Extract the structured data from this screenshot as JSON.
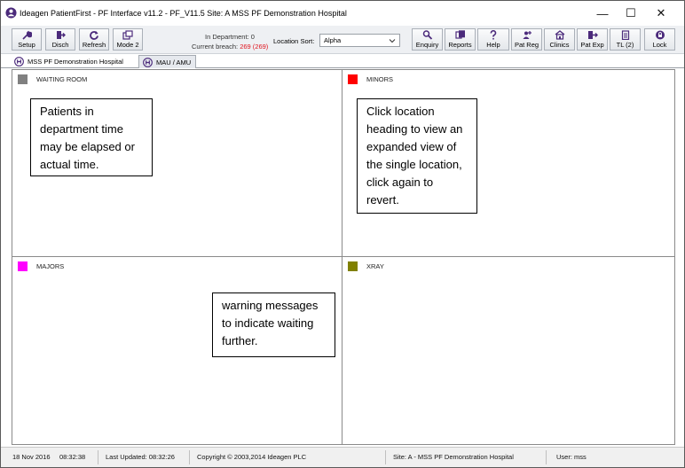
{
  "window": {
    "title": "Ideagen PatientFirst - PF Interface v11.2 - PF_V11.5 Site:  A    MSS PF  Demonstration  Hospital",
    "minimize_glyph": "—",
    "maximize_glyph": "☐",
    "close_glyph": "✕"
  },
  "toolbar": {
    "left_buttons": [
      {
        "label": "Setup",
        "icon": "wrench-icon"
      },
      {
        "label": "Disch",
        "icon": "discharge-icon"
      },
      {
        "label": "Refresh",
        "icon": "refresh-icon"
      },
      {
        "label": "Mode 2",
        "icon": "windows-icon"
      }
    ],
    "stats": {
      "in_department_label": "In Department: ",
      "in_department_value": "0",
      "current_breach_label": "Current breach: ",
      "current_breach_value": "269 (269)"
    },
    "location_sort": {
      "label": "Location Sort:",
      "value": "Alpha"
    },
    "right_buttons": [
      {
        "label": "Enquiry",
        "icon": "search-icon"
      },
      {
        "label": "Reports",
        "icon": "reports-icon"
      },
      {
        "label": "Help",
        "icon": "help-icon"
      },
      {
        "label": "Pat Reg",
        "icon": "patient-register-icon"
      },
      {
        "label": "Clinics",
        "icon": "clinic-icon"
      },
      {
        "label": "Pat Exp",
        "icon": "patient-export-icon"
      },
      {
        "label": "TL (2)",
        "icon": "task-list-icon"
      },
      {
        "label": "Lock",
        "icon": "lock-icon"
      }
    ]
  },
  "tabs": [
    {
      "label": "MSS PF  Demonstration  Hospital",
      "active": true
    },
    {
      "label": "MAU / AMU",
      "active": false
    }
  ],
  "locations": [
    {
      "name": "WAITING ROOM",
      "color": "#808080"
    },
    {
      "name": "MINORS",
      "color": "#ff0000"
    },
    {
      "name": "MAJORS",
      "color": "#ff00ff"
    },
    {
      "name": "XRAY",
      "color": "#808000"
    }
  ],
  "callouts": {
    "waiting": "Patients in department time may be elapsed or actual time.",
    "minors": "Click location heading to view an expanded view of the single location, click again to revert.",
    "majors": "warning messages to indicate waiting further."
  },
  "statusbar": {
    "date": "18 Nov 2016",
    "time": "08:32:38",
    "last_updated": "Last Updated: 08:32:26",
    "copyright": "Copyright © 2003,2014 Ideagen PLC",
    "site": "Site: A - MSS PF  Demonstration  Hospital",
    "user": "User: mss"
  },
  "colors": {
    "breach": "#e0141e",
    "icon_purple": "#4b2a7b"
  }
}
